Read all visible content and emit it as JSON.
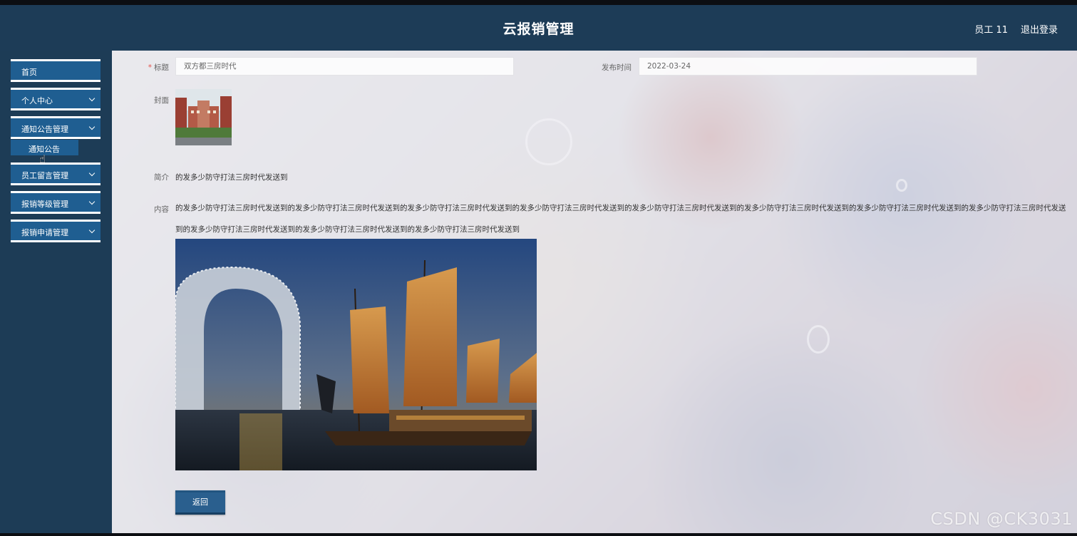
{
  "header": {
    "title": "云报销管理",
    "user": "员工 11",
    "logout": "退出登录"
  },
  "sidebar": {
    "items": [
      {
        "label": "首页"
      },
      {
        "label": "个人中心"
      },
      {
        "label": "通知公告管理"
      },
      {
        "label": "员工留言管理"
      },
      {
        "label": "报销等级管理"
      },
      {
        "label": "报销申请管理"
      }
    ],
    "submenu": {
      "label": "通知公告"
    }
  },
  "form": {
    "title_label": "标题",
    "title_value": "双方都三房时代",
    "date_label": "发布时间",
    "date_value": "2022-03-24",
    "cover_label": "封面",
    "intro_label": "简介",
    "intro_value": "的发多少防守打法三房时代发送到",
    "content_label": "内容",
    "content_value": "的发多少防守打法三房时代发送到的发多少防守打法三房时代发送到的发多少防守打法三房时代发送到的发多少防守打法三房时代发送到的发多少防守打法三房时代发送到的发多少防守打法三房时代发送到的发多少防守打法三房时代发送到的发多少防守打法三房时代发送到的发多少防守打法三房时代发送到的发多少防守打法三房时代发送到的发多少防守打法三房时代发送到",
    "back_label": "返回"
  },
  "watermark": "CSDN @CK3031",
  "colors": {
    "header_bg": "#1d3c57",
    "menu_bg": "#1f5e91",
    "button_bg": "#2a5f8e",
    "required": "#e4514b"
  }
}
